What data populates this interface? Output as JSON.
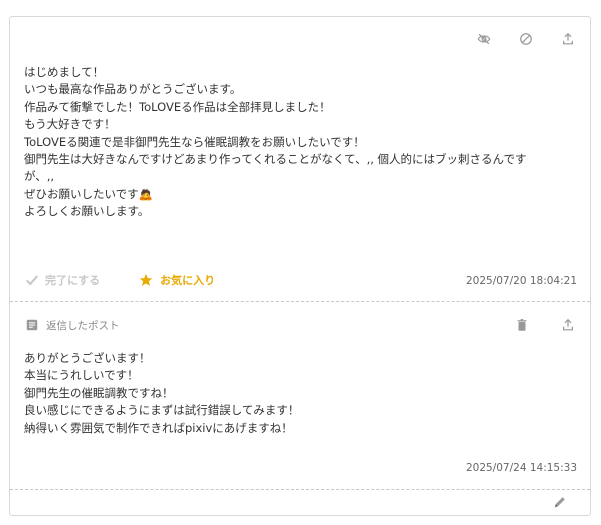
{
  "post": {
    "lines": [
      "はじめまして！",
      "いつも最高な作品ありがとうございます。",
      "作品みて衝撃でした！ToLOVEる作品は全部拝見しました！",
      "もう大好きです！",
      "ToLOVEる関連で是非御門先生なら催眠調教をお願いしたいです！",
      "御門先生は大好きなんですけどあまり作ってくれることがなくて、,, 個人的にはブッ刺さるんです",
      "が、,,",
      "ぜひお願いしたいです🙇",
      "よろしくお願いします。"
    ],
    "done_label": "完了にする",
    "favorite_label": "お気に入り",
    "timestamp": "2025/07/20 18:04:21"
  },
  "reply": {
    "header_label": "返信したポスト",
    "lines": [
      "ありがとうございます！",
      "本当にうれしいです！",
      "御門先生の催眠調教ですね！",
      "良い感じにできるようにまずは試行錯誤してみます！",
      "納得いく雰囲気で制作できればpixivにあげますね！"
    ],
    "timestamp": "2025/07/24 14:15:33"
  },
  "colors": {
    "favorite": "#e8a900",
    "muted": "#c8c8c8",
    "icon": "#999999"
  },
  "icons": [
    "eye-off-icon",
    "block-icon",
    "share-icon",
    "check-icon",
    "star-icon",
    "document-icon",
    "trash-icon",
    "pencil-icon"
  ]
}
